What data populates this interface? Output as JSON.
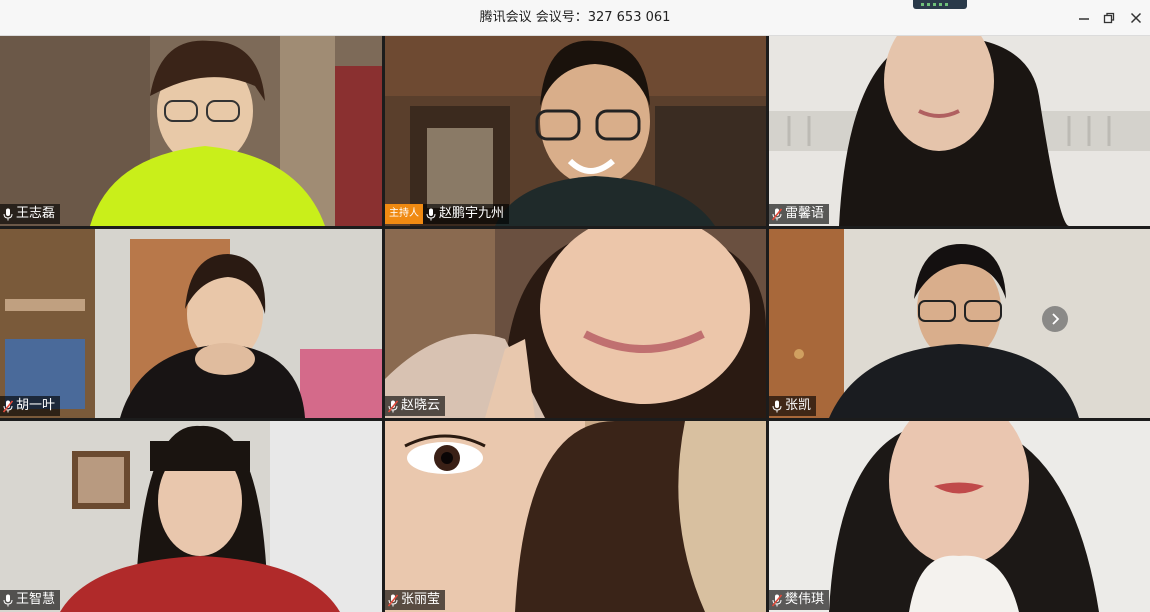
{
  "window": {
    "title": "腾讯会议 会议号：327 653 061",
    "minimize_icon": "minimize-icon",
    "restore_icon": "restore-icon",
    "close_icon": "close-icon"
  },
  "host_badge": "主持人",
  "participants": [
    {
      "name": "王志磊",
      "mic": "mic-on",
      "host": false
    },
    {
      "name": "赵鹏宇九州",
      "mic": "mic-on",
      "host": true
    },
    {
      "name": "雷馨语",
      "mic": "mic-muted",
      "host": false
    },
    {
      "name": "胡一叶",
      "mic": "mic-muted",
      "host": false
    },
    {
      "name": "赵晓云",
      "mic": "mic-muted",
      "host": false
    },
    {
      "name": "张凯",
      "mic": "mic-on",
      "host": false
    },
    {
      "name": "王智慧",
      "mic": "mic-on",
      "host": false
    },
    {
      "name": "张丽莹",
      "mic": "mic-muted",
      "host": false
    },
    {
      "name": "樊伟琪",
      "mic": "mic-muted",
      "host": false
    }
  ],
  "next_page_icon": "chevron-right-icon",
  "colors": {
    "host_badge": "#f08a12",
    "mic_muted": "#e04a3a",
    "mic_on": "#ffffff"
  }
}
